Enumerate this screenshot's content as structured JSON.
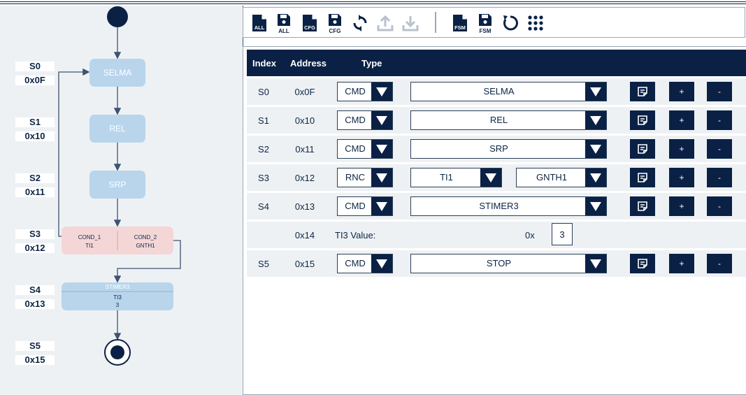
{
  "diagram": {
    "states": [
      {
        "index": "S0",
        "address": "0x0F"
      },
      {
        "index": "S1",
        "address": "0x10"
      },
      {
        "index": "S2",
        "address": "0x11"
      },
      {
        "index": "S3",
        "address": "0x12"
      },
      {
        "index": "S4",
        "address": "0x13"
      },
      {
        "index": "S5",
        "address": "0x15"
      }
    ],
    "nodes": {
      "selma": "SELMA",
      "rel": "REL",
      "srp": "SRP",
      "cond1": "COND_1",
      "cond1_val": "TI1",
      "cond2": "COND_2",
      "cond2_val": "GNTH1",
      "stimer": "STIMER3",
      "stimer_ti": "TI3",
      "stimer_val": "3"
    }
  },
  "toolbar": {
    "load_all": "ALL",
    "save_all": "ALL",
    "load_cfg": "CFG",
    "save_cfg": "CFG",
    "load_fsm": "FSM",
    "save_fsm": "FSM"
  },
  "table": {
    "headers": {
      "index": "Index",
      "address": "Address",
      "type": "Type"
    },
    "rows": [
      {
        "index": "S0",
        "address": "0x0F",
        "type": "CMD",
        "value": "SELMA"
      },
      {
        "index": "S1",
        "address": "0x10",
        "type": "CMD",
        "value": "REL"
      },
      {
        "index": "S2",
        "address": "0x11",
        "type": "CMD",
        "value": "SRP"
      },
      {
        "index": "S3",
        "address": "0x12",
        "type": "RNC",
        "cond1": "TI1",
        "cond2": "GNTH1"
      },
      {
        "index": "S4",
        "address": "0x13",
        "type": "CMD",
        "value": "STIMER3"
      },
      {
        "index": "S5",
        "address": "0x15",
        "type": "CMD",
        "value": "STOP"
      }
    ],
    "param_row": {
      "address": "0x14",
      "label": "TI3 Value:",
      "prefix": "0x",
      "value": "3"
    },
    "plus_label": "+",
    "minus_label": "-"
  },
  "colors": {
    "navy": "#0a2145",
    "node_blue": "#b8d5ec",
    "node_pink": "#f4d6d6",
    "panel_bg": "#eef1f4"
  }
}
